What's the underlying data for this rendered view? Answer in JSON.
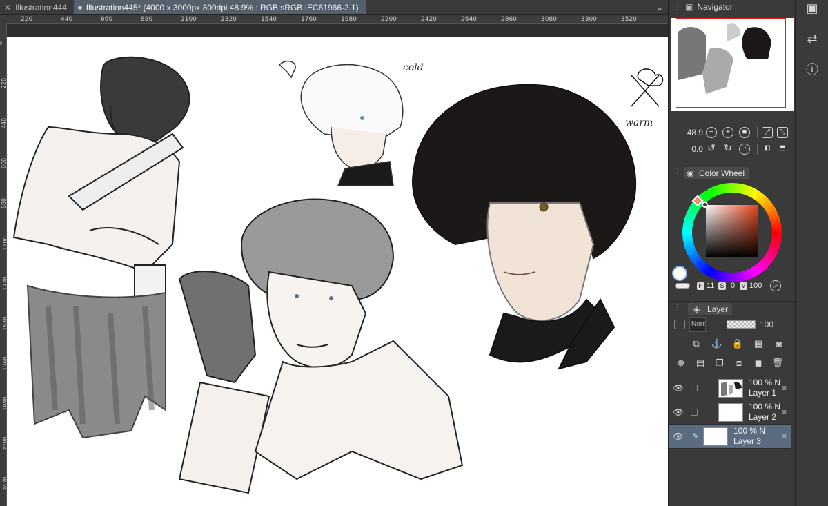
{
  "tabs": [
    {
      "label": "Illustration444",
      "active": false
    },
    {
      "label": "Illustration445* (4000 x 3000px 300dpi 48.9% : RGB:sRGB IEC61966-2.1)",
      "active": true
    }
  ],
  "ruler_h": [
    "220",
    "440",
    "660",
    "880",
    "1100",
    "1320",
    "1540",
    "1760",
    "1980",
    "2200",
    "2420",
    "2640",
    "2860",
    "3080",
    "3300",
    "3520"
  ],
  "ruler_v": [
    "0",
    "220",
    "440",
    "660",
    "880",
    "1100",
    "1320",
    "1540",
    "1760",
    "1980",
    "2200",
    "2420"
  ],
  "canvas_notes": {
    "cold": "cold",
    "warm": "warm"
  },
  "navigator": {
    "title": "Navigator",
    "zoom": "48.9",
    "rotation": "0.0"
  },
  "color_wheel": {
    "title": "Color Wheel",
    "h_label": "H",
    "h_value": "11",
    "s_label": "S",
    "s_value": "0",
    "v_label": "V",
    "v_value": "100",
    "fg_color": "#ffffff",
    "bg_color": "#1a1a2a"
  },
  "layer_panel": {
    "title": "Layer",
    "blend_mode": "Norm",
    "opacity": "100",
    "layers": [
      {
        "opacity": "100 % N",
        "name": "Layer 1",
        "selected": false
      },
      {
        "opacity": "100 % N",
        "name": "Layer 2",
        "selected": false
      },
      {
        "opacity": "100 % N",
        "name": "Layer 3",
        "selected": true
      }
    ]
  },
  "colors": {
    "accent_selected": "#5b6b80",
    "nav_frame": "#e02020"
  }
}
